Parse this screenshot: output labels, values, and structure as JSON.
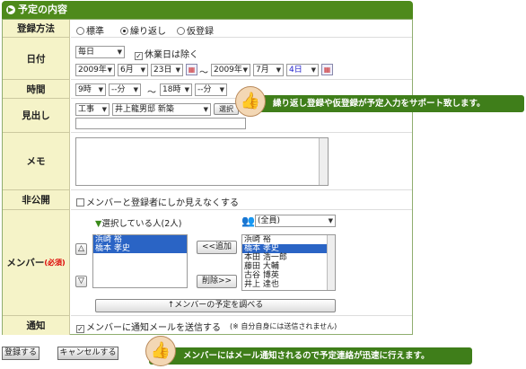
{
  "header": {
    "title": "予定の内容"
  },
  "labels": {
    "reg": "登録方法",
    "date": "日付",
    "time": "時間",
    "subject": "見出し",
    "memo": "メモ",
    "private": "非公開",
    "member": "メンバー",
    "required": "(必須)",
    "notify": "通知"
  },
  "reg": {
    "o1": "標準",
    "o2": "繰り返し",
    "o3": "仮登録",
    "selected": "繰り返し"
  },
  "date": {
    "repeat": "毎日",
    "holiday": "休業日は除く",
    "sy": "2009年",
    "sm": "6月",
    "sd": "23日",
    "tilde": "〜",
    "ey": "2009年",
    "em": "7月",
    "ed": "4日"
  },
  "time": {
    "sh": "9時",
    "smin": "--分",
    "tilde": "〜",
    "eh": "18時",
    "emin": "--分"
  },
  "subject": {
    "cat": "工事",
    "site": "井上龍男邸 新築",
    "btn": "選択",
    "value": ""
  },
  "private": {
    "label": "メンバーと登録者にしか見えなくする"
  },
  "member": {
    "selected_title": "選択している人(2人)",
    "selected": [
      "浜崎 裕",
      "橋本 孝史"
    ],
    "group": "(全員)",
    "all": [
      "浜崎 裕",
      "橋本 孝史",
      "本田 浩一郎",
      "藤田 大輔",
      "古谷 博英",
      "井上 達也"
    ],
    "add_btn": "<<追加",
    "del_btn": "削除>>",
    "up": "△",
    "down": "▽",
    "check_btn": "↑メンバーの予定を調べる"
  },
  "notify": {
    "label": "メンバーに通知メールを送信する",
    "note": "(※ 自分自身には送信されません)"
  },
  "buttons": {
    "register": "登録する",
    "cancel": "キャンセルする"
  },
  "tips": {
    "t1": "繰り返し登録や仮登録が予定入力をサポート致します。",
    "t2": "メンバーにはメール通知されるので予定連絡が迅速に行えます。"
  }
}
